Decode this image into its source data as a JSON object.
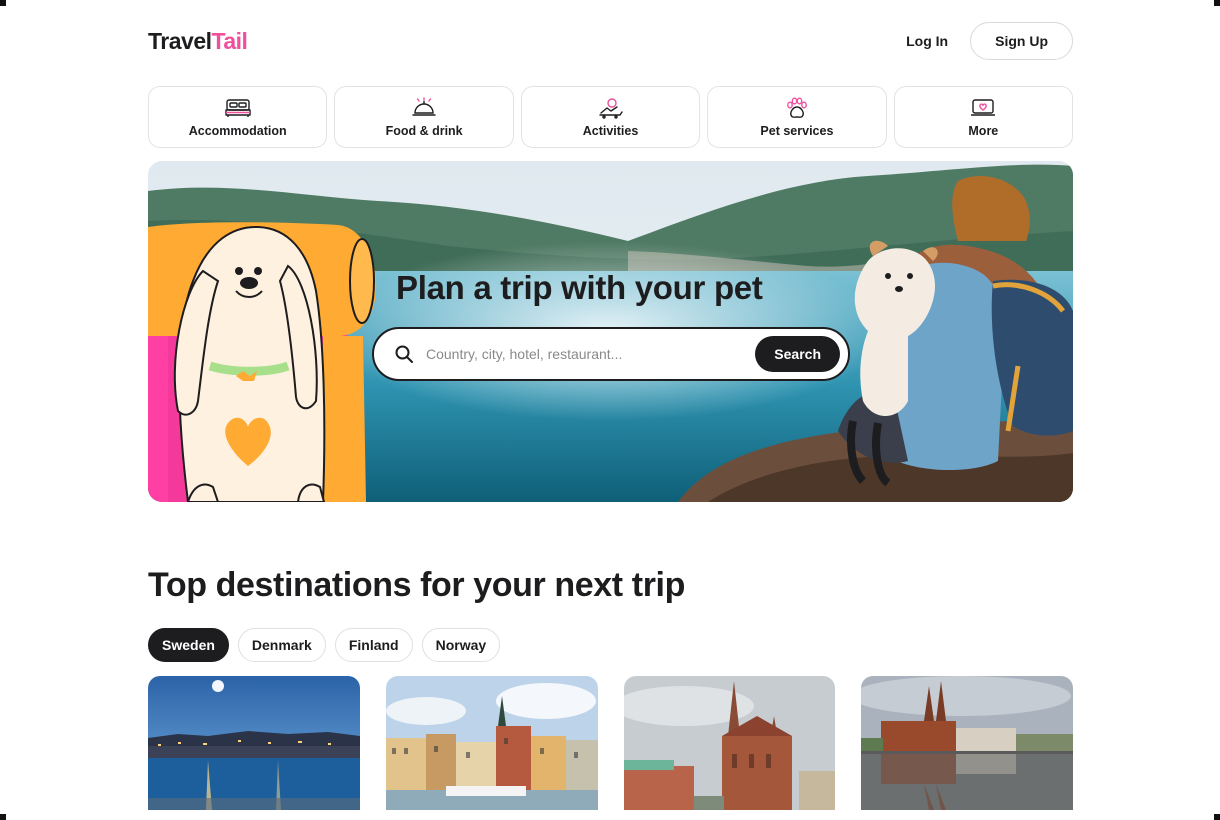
{
  "brand": {
    "logo_part1": "Travel",
    "logo_part2": "Tail",
    "accent": "#ef4f9b"
  },
  "header": {
    "login_label": "Log In",
    "signup_label": "Sign Up"
  },
  "categories": [
    {
      "label": "Accommodation",
      "icon": "bed-icon"
    },
    {
      "label": "Food & drink",
      "icon": "food-cloche-icon"
    },
    {
      "label": "Activities",
      "icon": "activities-icon"
    },
    {
      "label": "Pet services",
      "icon": "paw-icon"
    },
    {
      "label": "More",
      "icon": "more-icon"
    }
  ],
  "hero": {
    "title": "Plan a trip with your pet",
    "search_placeholder": "Country, city, hotel, restaurant...",
    "search_button": "Search"
  },
  "destinations": {
    "title": "Top destinations for your next trip",
    "tabs": [
      {
        "label": "Sweden",
        "active": true
      },
      {
        "label": "Denmark",
        "active": false
      },
      {
        "label": "Finland",
        "active": false
      },
      {
        "label": "Norway",
        "active": false
      }
    ],
    "cards": [
      {
        "image": "night-harbor-city-photo"
      },
      {
        "image": "old-town-waterfront-photo"
      },
      {
        "image": "gothic-cathedral-photo"
      },
      {
        "image": "cathedral-river-reflection-photo"
      }
    ]
  }
}
